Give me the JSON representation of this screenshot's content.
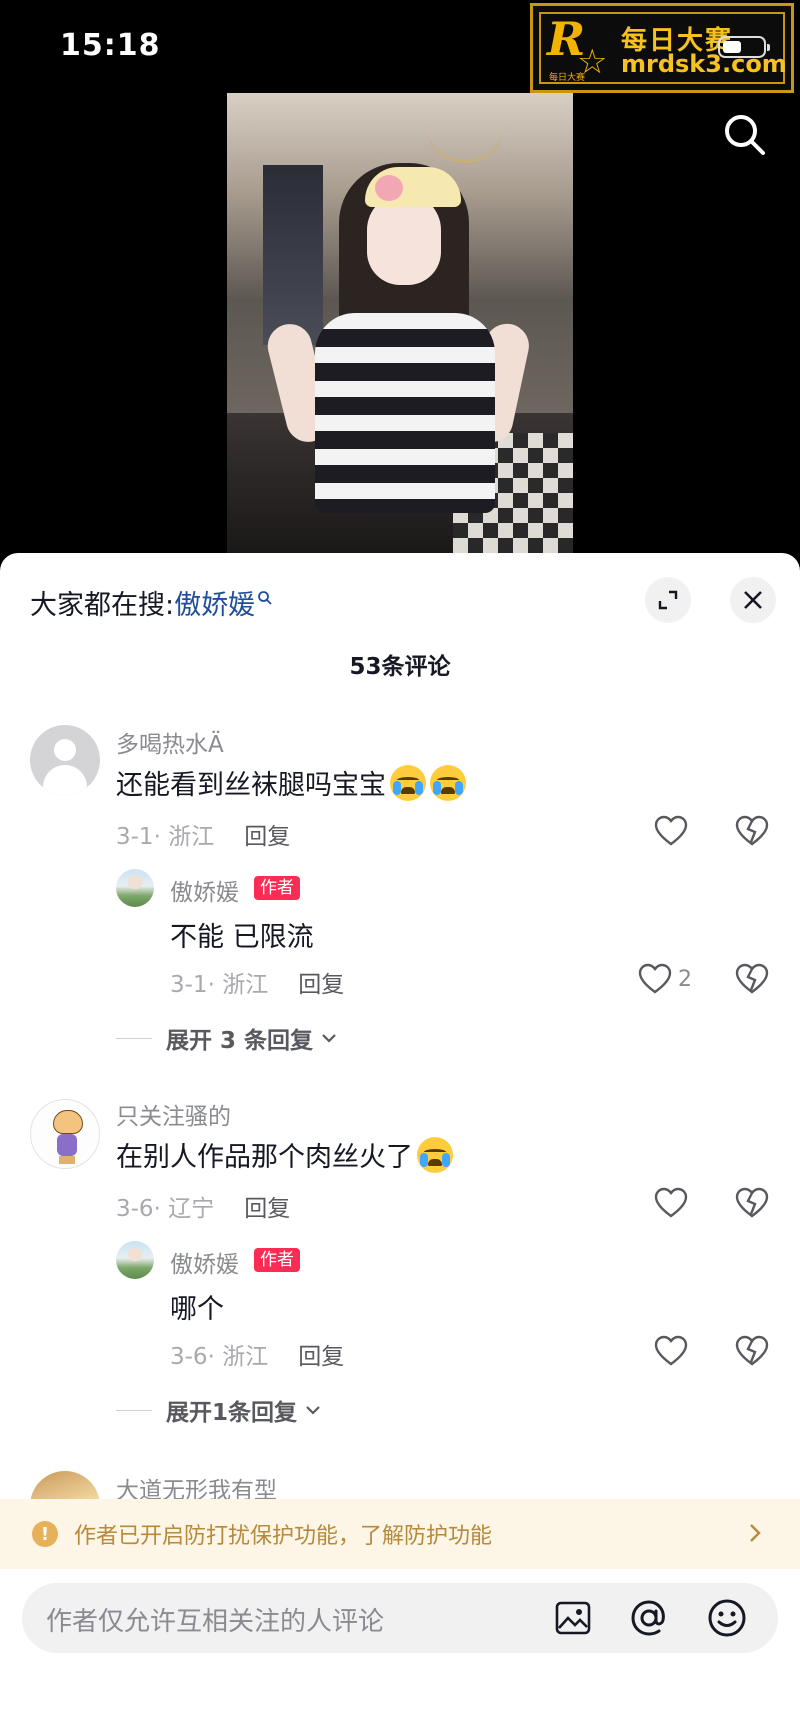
{
  "status_bar": {
    "time": "15:18"
  },
  "watermark": {
    "cn": "每日大赛",
    "en": "mrdsk3.com",
    "small": "每日大赛"
  },
  "sheet": {
    "trending_prefix": "大家都在搜:",
    "trending_keyword": "傲娇媛",
    "comment_count": "53条评论"
  },
  "comments": [
    {
      "user": "多喝热水Ä",
      "text": "还能看到丝袜腿吗宝宝",
      "date_loc": "3-1· 浙江",
      "reply_label": "回复",
      "reply": {
        "user": "傲娇媛",
        "tag": "作者",
        "text": "不能 已限流",
        "date_loc": "3-1· 浙江",
        "reply_label": "回复",
        "likes": "2"
      },
      "expand_label": "展开 3 条回复"
    },
    {
      "user": "只关注骚的",
      "text": "在别人作品那个肉丝火了",
      "date_loc": "3-6· 辽宁",
      "reply_label": "回复",
      "reply": {
        "user": "傲娇媛",
        "tag": "作者",
        "text": "哪个",
        "date_loc": "3-6· 浙江",
        "reply_label": "回复"
      },
      "expand_label": "展开1条回复"
    },
    {
      "user": "大道无形我有型"
    }
  ],
  "notice": {
    "text": "作者已开启防打扰保护功能，了解防护功能"
  },
  "input": {
    "placeholder": "作者仅允许互相关注的人评论"
  }
}
